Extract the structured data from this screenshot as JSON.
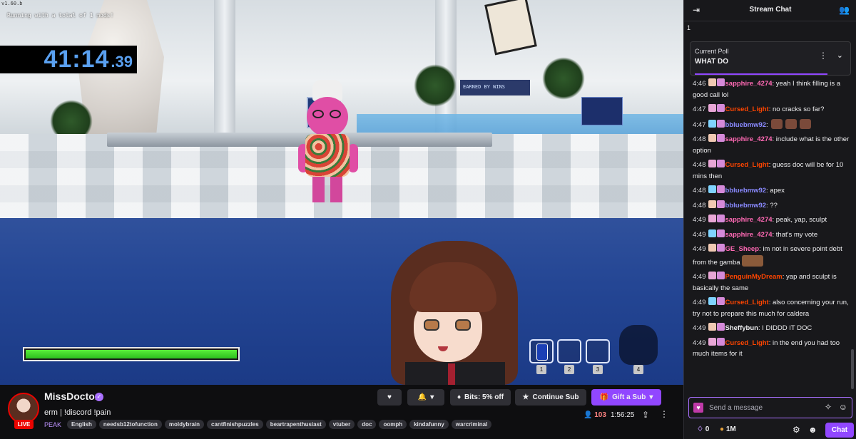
{
  "video": {
    "debug_version": "v1.60.b",
    "mods_text": "Running with a total of 1 mods!",
    "timer_main": "41:14",
    "timer_ms": ".39",
    "health_fraction": 1.0,
    "slots": [
      "1",
      "2",
      "3",
      "4"
    ],
    "sign_text": "EARNED BY WINS"
  },
  "channel": {
    "name": "MissDoctor",
    "live_label": "LIVE",
    "title": "erm | !discord !pain",
    "category": "PEAK",
    "tags": [
      "English",
      "needsb12tofunction",
      "moldybrain",
      "cantfinishpuzzles",
      "beartrapenthusiast",
      "vtuber",
      "doc",
      "oomph",
      "kindafunny",
      "warcriminal"
    ],
    "viewers": "103",
    "uptime": "1:56:25"
  },
  "actions": {
    "bits_label": "Bits: 5% off",
    "continue_sub_label": "Continue Sub",
    "gift_sub_label": "Gift a Sub"
  },
  "chat": {
    "header": "Stream Chat",
    "pinned_count": "1",
    "poll_label": "Current Poll",
    "poll_question": "WHAT DO",
    "input_placeholder": "Send a message",
    "points": "0",
    "bits": "1M",
    "send_label": "Chat",
    "colors": {
      "sapphire_4274": "#ff69b4",
      "Cursed_Light": "#ff4500",
      "bbluebmw92": "#8a8aff",
      "GE_Sheep": "#ff69b4",
      "PenguinMyDream": "#ff4500",
      "Sheffybun": "#efeff1"
    },
    "messages": [
      {
        "ts": "4:46",
        "user": "sapphire_4274",
        "text": "yeah I think filling is a good call lol"
      },
      {
        "ts": "4:47",
        "user": "Cursed_Light",
        "text": "no cracks so far?"
      },
      {
        "ts": "4:47",
        "user": "bbluebmw92",
        "text": ""
      },
      {
        "ts": "4:48",
        "user": "sapphire_4274",
        "text": "include what is the other option"
      },
      {
        "ts": "4:48",
        "user": "Cursed_Light",
        "text": "guess doc will be for 10 mins then"
      },
      {
        "ts": "4:48",
        "user": "bbluebmw92",
        "text": "apex"
      },
      {
        "ts": "4:48",
        "user": "bbluebmw92",
        "text": "??"
      },
      {
        "ts": "4:49",
        "user": "sapphire_4274",
        "text": "peak, yap, sculpt"
      },
      {
        "ts": "4:49",
        "user": "sapphire_4274",
        "text": "that's my vote"
      },
      {
        "ts": "4:49",
        "user": "GE_Sheep",
        "text": "im not in severe point debt from the gamba"
      },
      {
        "ts": "4:49",
        "user": "PenguinMyDream",
        "text": "yap and sculpt is basically the same"
      },
      {
        "ts": "4:49",
        "user": "Cursed_Light",
        "text": "also concerning your run, try not to prepare this much for caldera"
      },
      {
        "ts": "4:49",
        "user": "Sheffybun",
        "text": "I DIDDD IT DOC"
      },
      {
        "ts": "4:49",
        "user": "Cursed_Light",
        "text": "in the end you had too much items for it"
      }
    ]
  }
}
